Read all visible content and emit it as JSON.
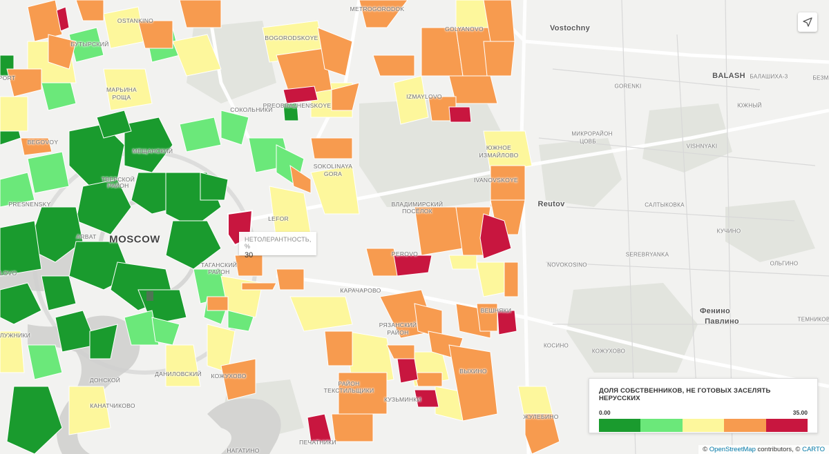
{
  "map": {
    "labels": [
      {
        "text": "OSTANKINO",
        "cls": ""
      },
      {
        "text": "БУТЫРСКИЙ",
        "cls": ""
      },
      {
        "text": "METROGORODOK",
        "cls": ""
      },
      {
        "text": "BOGORODSKOYE",
        "cls": ""
      },
      {
        "text": "GOLYANOVO",
        "cls": ""
      },
      {
        "text": "Vostochny",
        "cls": "town"
      },
      {
        "text": "BALASH",
        "cls": "town-cap"
      },
      {
        "text": "БАЛАШИХА-3",
        "cls": "lightsmall"
      },
      {
        "text": "БЕЗМ",
        "cls": "lightsmall"
      },
      {
        "text": "PORT",
        "cls": ""
      },
      {
        "text": "МАРЬИНА",
        "cls": ""
      },
      {
        "text": "РОЩА",
        "cls": ""
      },
      {
        "text": "PREOBRAZHENSKOYE",
        "cls": ""
      },
      {
        "text": "СОКОЛЬНИКИ",
        "cls": ""
      },
      {
        "text": "IZMAYLOVO",
        "cls": ""
      },
      {
        "text": "GORENKI",
        "cls": "lightsmall"
      },
      {
        "text": "ЮЖНЫЙ",
        "cls": "lightsmall"
      },
      {
        "text": "МИКРОРАЙОН",
        "cls": "lightsmall"
      },
      {
        "text": "ЦОВБ",
        "cls": "lightsmall"
      },
      {
        "text": "BEGOVOY",
        "cls": ""
      },
      {
        "text": "МЕЩАНСКИЙ",
        "cls": ""
      },
      {
        "text": "ЮЖНОЕ",
        "cls": ""
      },
      {
        "text": "ИЗМАЙЛОВО",
        "cls": ""
      },
      {
        "text": "VISHNYAKI",
        "cls": "lightsmall"
      },
      {
        "text": "SOKOLINAYA",
        "cls": ""
      },
      {
        "text": "GORA",
        "cls": ""
      },
      {
        "text": "ТВЕРСКОЙ",
        "cls": ""
      },
      {
        "text": "РАЙОН",
        "cls": ""
      },
      {
        "text": "IVANOVSKOYE",
        "cls": ""
      },
      {
        "text": "PRESNENSKY",
        "cls": ""
      },
      {
        "text": "ВЛАДИМИРСКИЙ",
        "cls": ""
      },
      {
        "text": "ПОСЁЛОК",
        "cls": ""
      },
      {
        "text": "Reutov",
        "cls": "town"
      },
      {
        "text": "САЛТЫКОВКА",
        "cls": "lightsmall"
      },
      {
        "text": "LEFOR",
        "cls": ""
      },
      {
        "text": "MOSCOW",
        "cls": "city"
      },
      {
        "text": "ARBAT",
        "cls": ""
      },
      {
        "text": "КУЧИНО",
        "cls": "lightsmall"
      },
      {
        "text": "PEROVO",
        "cls": ""
      },
      {
        "text": "ТАГАНСКИЙ",
        "cls": ""
      },
      {
        "text": "РАЙОН",
        "cls": ""
      },
      {
        "text": "SEREBRYANKA",
        "cls": "lightsmall"
      },
      {
        "text": "NOVOKOSINO",
        "cls": "lightsmall"
      },
      {
        "text": "ОЛЬГИНО",
        "cls": "lightsmall"
      },
      {
        "text": "LOVO",
        "cls": ""
      },
      {
        "text": "КАРАЧАРОВО",
        "cls": ""
      },
      {
        "text": "ВЕШНЯКИ",
        "cls": ""
      },
      {
        "text": "Фенино",
        "cls": "town"
      },
      {
        "text": "Павлино",
        "cls": "town"
      },
      {
        "text": "ТЕМНИКОВ",
        "cls": "lightsmall"
      },
      {
        "text": "ЛУЖНИКИ",
        "cls": ""
      },
      {
        "text": "РЯЗАНСКИЙ",
        "cls": ""
      },
      {
        "text": "РАЙОН",
        "cls": ""
      },
      {
        "text": "КОСИНО",
        "cls": "lightsmall"
      },
      {
        "text": "КОЖУХОВО",
        "cls": "lightsmall"
      },
      {
        "text": "ДАНИЛОВСКИЙ",
        "cls": ""
      },
      {
        "text": "КОЖУХОВО",
        "cls": ""
      },
      {
        "text": "ВЫХИНО",
        "cls": ""
      },
      {
        "text": "ДОНСКОЙ",
        "cls": ""
      },
      {
        "text": "РАЙОН",
        "cls": ""
      },
      {
        "text": "ТЕКСТИЛЬЩИКИ",
        "cls": ""
      },
      {
        "text": "КУЗЬМИНКИ",
        "cls": ""
      },
      {
        "text": "КАНАТЧИКОВО",
        "cls": ""
      },
      {
        "text": "ЖУЛЕБИНО",
        "cls": ""
      },
      {
        "text": "ПЕЧАТНИКИ",
        "cls": ""
      },
      {
        "text": "НАГАТИНО",
        "cls": ""
      }
    ]
  },
  "tooltip": {
    "title": "НЕТОЛЕРАНТНОСТЬ, %",
    "value": "30"
  },
  "legend": {
    "title": "ДОЛЯ СОБСТВЕННИКОВ, НЕ ГОТОВЫХ ЗАСЕЛЯТЬ НЕРУССКИХ",
    "min": "0.00",
    "max": "35.00",
    "colors": [
      "#1a9b2e",
      "#6be87a",
      "#fdf79c",
      "#f79b4f",
      "#c8163f"
    ]
  },
  "attribution": {
    "copy1": "©",
    "osm": "OpenStreetMap",
    "contributors": "contributors, ©",
    "carto": "CARTO"
  },
  "controls": {
    "locate_icon": "navigation-arrow-icon"
  }
}
